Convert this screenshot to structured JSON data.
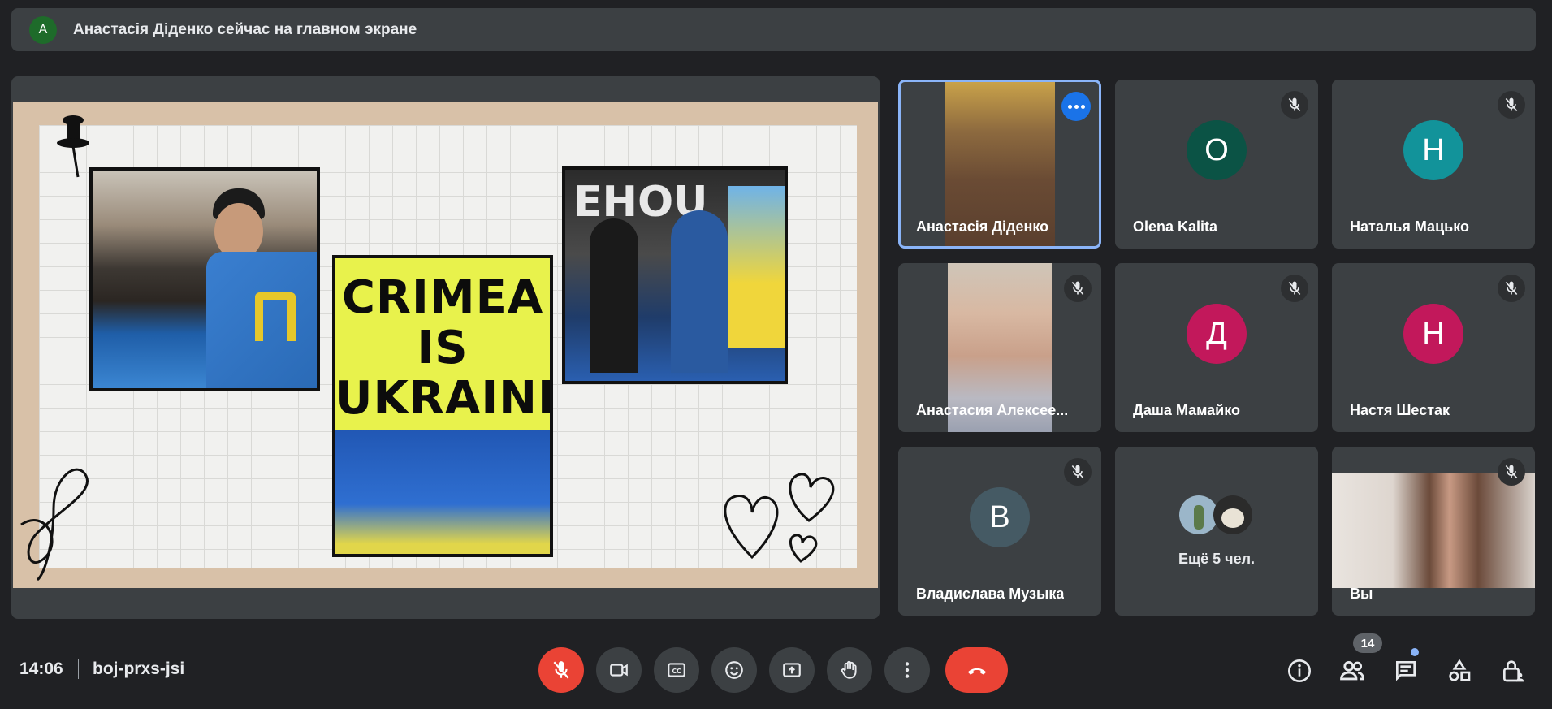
{
  "banner": {
    "avatar_letter": "A",
    "avatar_color": "#1e6b2a",
    "text": "Анастасія Діденко сейчас на главном экране"
  },
  "presentation": {
    "sign_text": [
      "CRIMEA",
      "IS",
      "UKRAINE"
    ],
    "wall_text": "EHOU"
  },
  "participants": [
    {
      "name": "Анастасія Діденко",
      "type": "video",
      "active": true
    },
    {
      "name": "Olena Kalita",
      "type": "avatar",
      "letter": "O",
      "color": "#0b5345",
      "muted": true
    },
    {
      "name": "Наталья Мацько",
      "type": "avatar",
      "letter": "Н",
      "color": "#12939a",
      "muted": true
    },
    {
      "name": "Анастасия Алексее...",
      "type": "video",
      "muted": true
    },
    {
      "name": "Даша Мамайко",
      "type": "avatar",
      "letter": "Д",
      "color": "#c2185b",
      "muted": true
    },
    {
      "name": "Настя Шестак",
      "type": "avatar",
      "letter": "Н",
      "color": "#c2185b",
      "muted": true
    },
    {
      "name": "Владислава Музыка",
      "type": "avatar",
      "letter": "В",
      "color": "#455a64",
      "muted": true
    },
    {
      "name": "Ещё 5 чел.",
      "type": "more"
    },
    {
      "name": "Вы",
      "type": "video",
      "muted": true
    }
  ],
  "bottom": {
    "time": "14:06",
    "meeting_code": "boj-prxs-jsi",
    "participant_count": "14"
  },
  "controls": {
    "mic": "mic-off-icon",
    "camera": "camera-icon",
    "captions": "captions-icon",
    "reactions": "emoji-icon",
    "present": "present-screen-icon",
    "raise_hand": "hand-icon",
    "more": "more-vert-icon",
    "hangup": "hangup-icon"
  },
  "colors": {
    "accent": "#8ab4f8",
    "danger": "#ea4335",
    "tile": "#3c4043",
    "background": "#202124"
  }
}
